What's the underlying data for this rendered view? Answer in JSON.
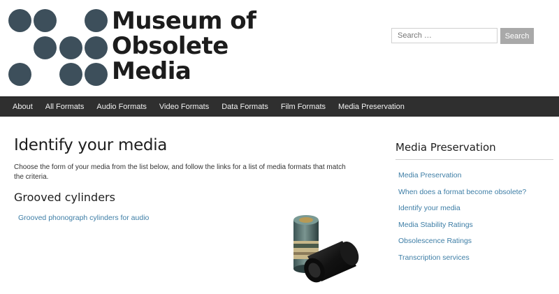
{
  "site": {
    "title_lines": [
      "Museum of",
      "Obsolete",
      "Media"
    ],
    "logo_color": "#3d4f5b"
  },
  "search": {
    "placeholder": "Search …",
    "button_label": "Search"
  },
  "nav": {
    "items": [
      "About",
      "All Formats",
      "Audio Formats",
      "Video Formats",
      "Data Formats",
      "Film Formats",
      "Media Preservation"
    ]
  },
  "main": {
    "title": "Identify your media",
    "intro": "Choose the form of your media from the list below, and follow the links for a list of media formats that match the criteria.",
    "section_heading": "Grooved cylinders",
    "link_label": "Grooved phonograph cylinders for audio"
  },
  "sidebar": {
    "title": "Media Preservation",
    "items": [
      "Media Preservation",
      "When does a format become obsolete?",
      "Identify your media",
      "Media Stability Ratings",
      "Obsolescence Ratings",
      "Transcription services"
    ]
  },
  "colors": {
    "link": "#3e7ea6",
    "nav_bg": "#2f2f2f",
    "search_button": "#a9a9a9"
  }
}
